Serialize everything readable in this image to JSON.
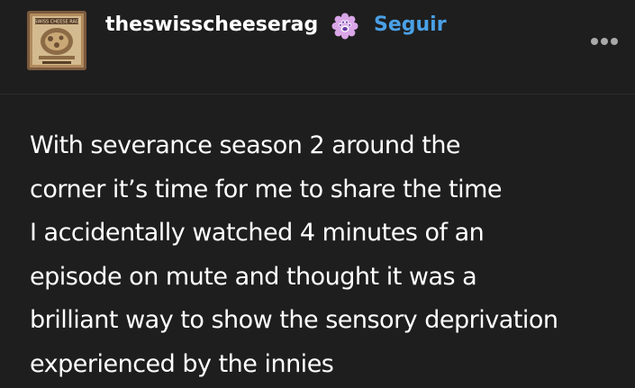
{
  "post": {
    "author": {
      "username": "theswisscheeserag",
      "avatar_caption": "SWISS CHEESE RAG",
      "badge_icon": "paw-badge-icon"
    },
    "actions": {
      "follow_label": "Seguir",
      "more_icon": "more-options-icon"
    },
    "body_lines": [
      "With severance season 2 around the",
      "corner it’s time for me to share the time",
      "I accidentally watched 4 minutes of an",
      "episode on mute and thought it was a",
      "brilliant way to show the sensory deprivation",
      "experienced by the innies"
    ]
  },
  "colors": {
    "background": "#1e1e1e",
    "text": "#ffffff",
    "follow_link": "#4aa0e6",
    "badge": "#d9a6e8",
    "more_dots": "#a9a9a9"
  }
}
